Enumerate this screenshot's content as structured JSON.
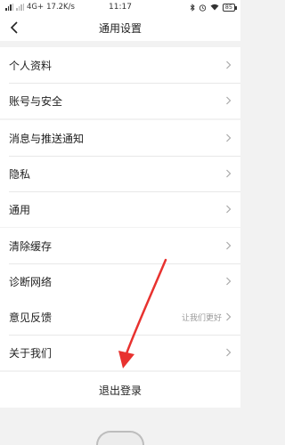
{
  "status_bar": {
    "network": "4G+",
    "speed": "17.2K/s",
    "time": "11:17",
    "battery": "85"
  },
  "header": {
    "title": "通用设置"
  },
  "groups": [
    {
      "items": [
        {
          "label": "个人资料"
        },
        {
          "label": "账号与安全"
        }
      ]
    },
    {
      "items": [
        {
          "label": "消息与推送通知"
        },
        {
          "label": "隐私"
        },
        {
          "label": "通用"
        }
      ]
    },
    {
      "items": [
        {
          "label": "清除缓存"
        },
        {
          "label": "诊断网络"
        }
      ]
    },
    {
      "items": [
        {
          "label": "意见反馈",
          "hint": "让我们更好"
        },
        {
          "label": "关于我们"
        }
      ]
    }
  ],
  "logout": {
    "label": "退出登录"
  },
  "colors": {
    "annotation_arrow": "#e8322f",
    "background": "#f2f2f2"
  },
  "icons": [
    "back-arrow-icon",
    "chevron-right-icon",
    "bluetooth-icon",
    "alarm-icon",
    "wifi-icon",
    "battery-icon"
  ]
}
